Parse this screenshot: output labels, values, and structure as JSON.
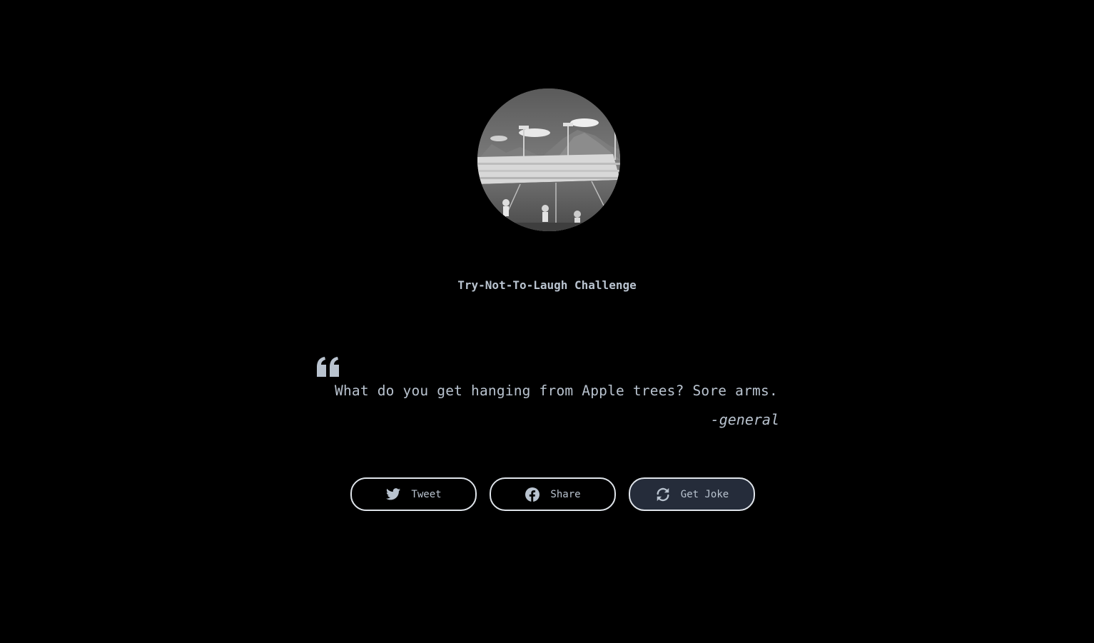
{
  "header": {
    "title": "Try-Not-To-Laugh Challenge"
  },
  "joke": {
    "text": "What do you get hanging from Apple trees? Sore arms.",
    "author": "-general"
  },
  "buttons": {
    "tweet_label": "Tweet",
    "share_label": "Share",
    "get_joke_label": "Get Joke"
  },
  "icons": {
    "avatar": "stadium-photo",
    "quote": "quote-left-icon",
    "tweet": "twitter-icon",
    "share": "facebook-icon",
    "get_joke": "refresh-icon"
  },
  "colors": {
    "background": "#000000",
    "text": "#b9c3cf",
    "button_border": "#dfe4ea",
    "button_active_bg": "#252c3a"
  }
}
